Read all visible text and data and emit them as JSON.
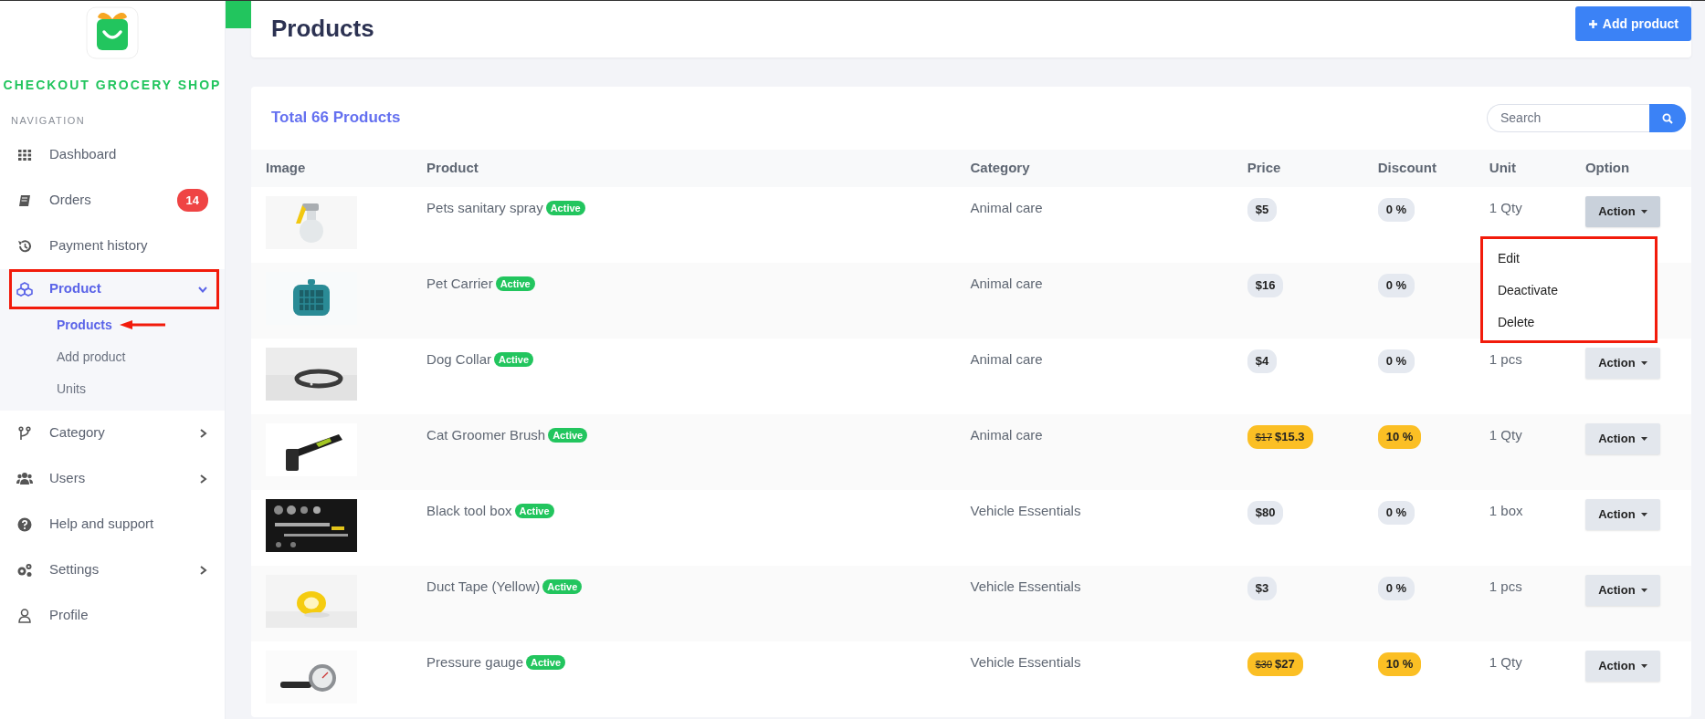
{
  "sidebar": {
    "brand": "CHECKOUT GROCERY SHOP",
    "section_label": "NAVIGATION",
    "items": [
      {
        "label": "Dashboard",
        "selected": false
      },
      {
        "label": "Orders",
        "selected": false,
        "badge": "14"
      },
      {
        "label": "Payment history",
        "selected": false
      },
      {
        "label": "Product",
        "selected": true,
        "expanded": true,
        "annotated": true,
        "children": [
          {
            "label": "Products",
            "selected": true,
            "annotated": true
          },
          {
            "label": "Add product",
            "selected": false
          },
          {
            "label": "Units",
            "selected": false
          }
        ]
      },
      {
        "label": "Category",
        "selected": false,
        "expanded": false
      },
      {
        "label": "Users",
        "selected": false,
        "expanded": false
      },
      {
        "label": "Help and support",
        "selected": false
      },
      {
        "label": "Settings",
        "selected": false,
        "expanded": false
      },
      {
        "label": "Profile",
        "selected": false
      }
    ]
  },
  "header": {
    "title": "Products",
    "add_button": "Add product"
  },
  "products": {
    "total": "Total 66 Products",
    "search": {
      "placeholder": "Search"
    },
    "columns": [
      "Image",
      "Product",
      "Category",
      "Price",
      "Discount",
      "Unit",
      "Option"
    ],
    "rows": [
      {
        "name": "Pets sanitary spray",
        "status": "Active",
        "category": "Animal care",
        "price": "$5",
        "discount": "0 %",
        "discounted": false,
        "unit": "1 Qty",
        "action": {
          "label": "Action",
          "open": true,
          "menu": {
            "annotated": true,
            "items": [
              "Edit",
              "Deactivate",
              "Delete"
            ]
          }
        }
      },
      {
        "name": "Pet Carrier",
        "status": "Active",
        "category": "Animal care",
        "price": "$16",
        "discount": "0 %",
        "discounted": false
      },
      {
        "name": "Dog Collar",
        "status": "Active",
        "category": "Animal care",
        "price": "$4",
        "discount": "0 %",
        "discounted": false,
        "unit": "1 pcs",
        "action": {
          "label": "Action",
          "open": false
        }
      },
      {
        "name": "Cat Groomer Brush",
        "status": "Active",
        "category": "Animal care",
        "old_price": "$17",
        "price": "$15.3",
        "discount": "10 %",
        "discounted": true,
        "unit": "1 Qty",
        "action": {
          "label": "Action",
          "open": false
        }
      },
      {
        "name": "Black tool box",
        "status": "Active",
        "category": "Vehicle Essentials",
        "price": "$80",
        "discount": "0 %",
        "discounted": false,
        "unit": "1 box",
        "action": {
          "label": "Action",
          "open": false
        }
      },
      {
        "name": "Duct Tape (Yellow)",
        "status": "Active",
        "category": "Vehicle Essentials",
        "price": "$3",
        "discount": "0 %",
        "discounted": false,
        "unit": "1 pcs",
        "action": {
          "label": "Action",
          "open": false
        }
      },
      {
        "name": "Pressure gauge",
        "status": "Active",
        "category": "Vehicle Essentials",
        "old_price": "$30",
        "price": "$27",
        "discount": "10 %",
        "discounted": true,
        "unit": "1 Qty",
        "action": {
          "label": "Action",
          "open": false
        }
      }
    ]
  }
}
